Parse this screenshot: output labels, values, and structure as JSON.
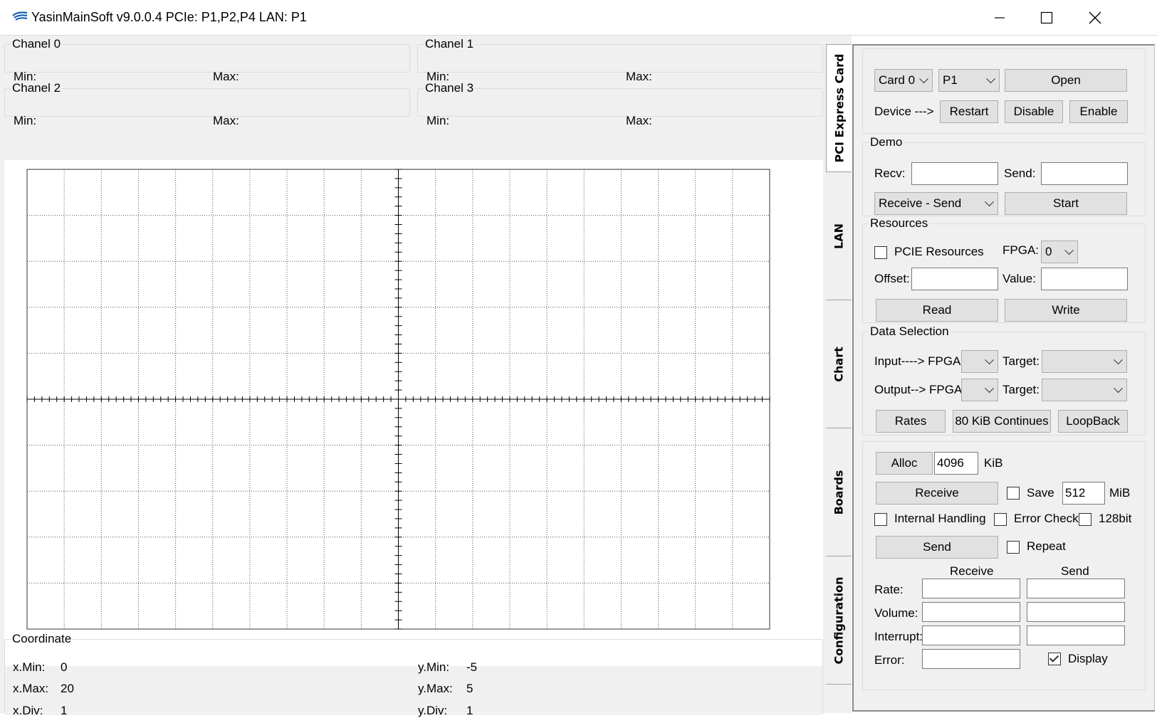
{
  "window": {
    "title": "YasinMainSoft v9.0.0.4 PCIe: P1,P2,P4 LAN: P1"
  },
  "channels": [
    {
      "label": "Chanel 0",
      "min_label": "Min:",
      "max_label": "Max:"
    },
    {
      "label": "Chanel 1",
      "min_label": "Min:",
      "max_label": "Max:"
    },
    {
      "label": "Chanel 2",
      "min_label": "Min:",
      "max_label": "Max:"
    },
    {
      "label": "Chanel 3",
      "min_label": "Min:",
      "max_label": "Max:"
    }
  ],
  "coordinate": {
    "label": "Coordinate",
    "x_min_label": "x.Min:",
    "x_min": "0",
    "x_max_label": "x.Max:",
    "x_max": "20",
    "x_div_label": "x.Div:",
    "x_div": "1",
    "y_min_label": "y.Min:",
    "y_min": "-5",
    "y_max_label": "y.Max:",
    "y_max": "5",
    "y_div_label": "y.Div:",
    "y_div": "1"
  },
  "tabs": [
    "PCI Express Card",
    "LAN",
    "Chart",
    "Boards",
    "Configuration"
  ],
  "card": {
    "card_select": "Card 0",
    "port_select": "P1",
    "open": "Open",
    "device_label": "Device --->",
    "restart": "Restart",
    "disable": "Disable",
    "enable": "Enable"
  },
  "demo": {
    "label": "Demo",
    "recv_label": "Recv:",
    "send_label": "Send:",
    "mode_select": "Receive - Send",
    "start": "Start"
  },
  "resources": {
    "label": "Resources",
    "pcie_resources": "PCIE Resources",
    "fpga_label": "FPGA:",
    "fpga_select": "0",
    "offset_label": "Offset:",
    "value_label": "Value:",
    "read": "Read",
    "write": "Write"
  },
  "data_selection": {
    "label": "Data Selection",
    "input_label": "Input----> FPGA:",
    "output_label": "Output--> FPGA:",
    "target_label": "Target:",
    "rates": "Rates",
    "continues": "80 KiB Continues",
    "loopback": "LoopBack"
  },
  "transfer": {
    "alloc": "Alloc",
    "alloc_value": "4096",
    "alloc_unit": "KiB",
    "receive": "Receive",
    "save": "Save",
    "save_value": "512",
    "save_unit": "MiB",
    "internal_handling": "Internal Handling",
    "error_check": "Error Check",
    "bit128": "128bit",
    "send": "Send",
    "repeat": "Repeat",
    "col_receive": "Receive",
    "col_send": "Send",
    "rate_label": "Rate:",
    "volume_label": "Volume:",
    "interrupt_label": "Interrupt:",
    "error_label": "Error:",
    "display": "Display",
    "display_checked": true
  }
}
